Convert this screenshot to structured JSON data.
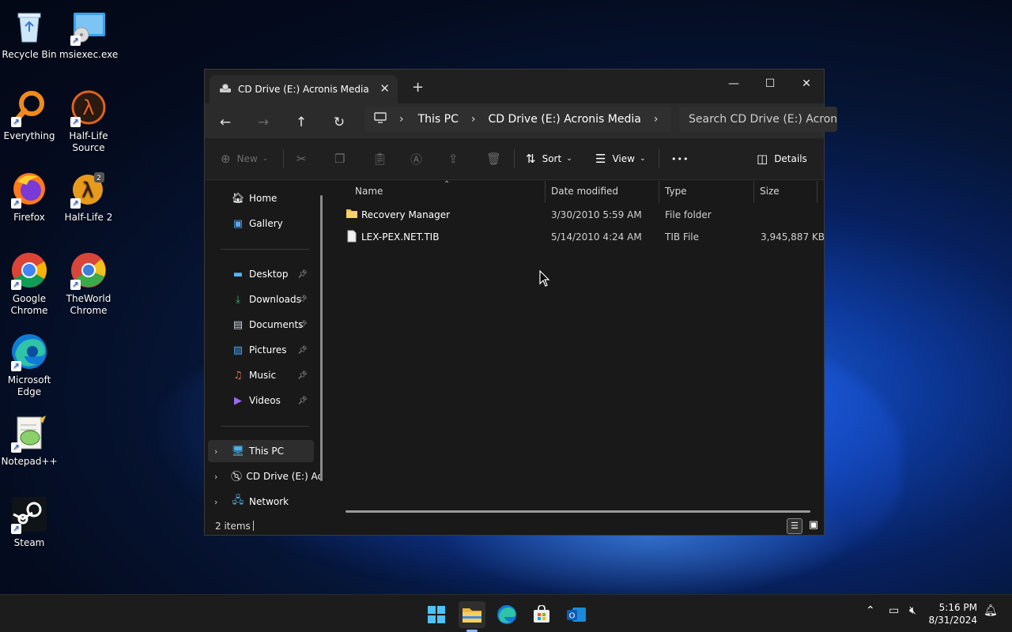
{
  "desktop": {
    "icons": [
      {
        "label": "Recycle Bin",
        "icon": "recycle-bin-icon"
      },
      {
        "label": "msiexec.exe",
        "icon": "installer-icon"
      },
      {
        "label": "Everything",
        "icon": "everything-search-icon"
      },
      {
        "label": "Half-Life Source",
        "icon": "half-life-icon"
      },
      {
        "label": "Firefox",
        "icon": "firefox-icon"
      },
      {
        "label": "Half-Life 2",
        "icon": "half-life-2-icon"
      },
      {
        "label": "Google Chrome",
        "icon": "chrome-icon"
      },
      {
        "label": "TheWorld Chrome",
        "icon": "theworld-icon"
      },
      {
        "label": "Microsoft Edge",
        "icon": "edge-icon"
      },
      {
        "label": "Notepad++",
        "icon": "notepadpp-icon"
      },
      {
        "label": "Steam",
        "icon": "steam-icon"
      }
    ]
  },
  "window": {
    "tab_title": "CD Drive (E:) Acronis Media",
    "close_tab_glyph": "✕",
    "new_tab_glyph": "+",
    "minimize_glyph": "—",
    "maximize_glyph": "☐",
    "close_glyph": "✕"
  },
  "address": {
    "crumbs": [
      "This PC",
      "CD Drive (E:) Acronis Media"
    ],
    "search_placeholder": "Search CD Drive (E:) Acronis Media"
  },
  "commands": {
    "new": "New",
    "sort": "Sort",
    "view": "View",
    "more": "•••",
    "details": "Details"
  },
  "nav": {
    "home": "Home",
    "gallery": "Gallery",
    "pinned": [
      {
        "label": "Desktop",
        "icon": "desktop-folder-icon"
      },
      {
        "label": "Downloads",
        "icon": "downloads-icon"
      },
      {
        "label": "Documents",
        "icon": "documents-icon"
      },
      {
        "label": "Pictures",
        "icon": "pictures-icon"
      },
      {
        "label": "Music",
        "icon": "music-icon"
      },
      {
        "label": "Videos",
        "icon": "videos-icon"
      }
    ],
    "this_pc": "This PC",
    "cd_drive": "CD Drive (E:) Ac",
    "network": "Network"
  },
  "columns": {
    "name": "Name",
    "date": "Date modified",
    "type": "Type",
    "size": "Size"
  },
  "files": [
    {
      "name": "Recovery Manager",
      "date": "3/30/2010 5:59 AM",
      "type": "File folder",
      "size": ""
    },
    {
      "name": "LEX-PEX.NET.TIB",
      "date": "5/14/2010 4:24 AM",
      "type": "TIB File",
      "size": "3,945,887 KB"
    }
  ],
  "status": {
    "item_count": "2 items"
  },
  "taskbar": {
    "time": "5:16 PM",
    "date": "8/31/2024"
  }
}
